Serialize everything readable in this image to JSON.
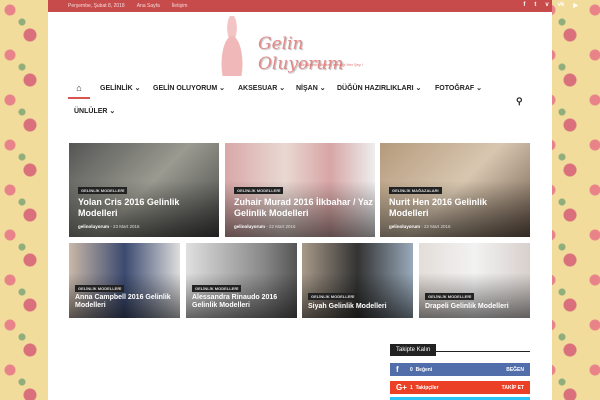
{
  "topbar": {
    "date": "Perşembe, Şubat 8, 2018",
    "links": [
      "Ana Sayfa",
      "İletişim"
    ],
    "social": [
      "facebook-icon",
      "twitter-icon",
      "vimeo-icon",
      "vk-icon",
      "youtube-icon"
    ]
  },
  "logo": {
    "name": "Gelin Oluyorum",
    "tagline": "Bir Gelinin Bilmek İstediği Her Şey !"
  },
  "nav": {
    "items": [
      "GELİNLİK",
      "GELİN OLUYORUM",
      "AKSESUAR",
      "NİŞAN",
      "DÜĞÜN HAZIRLIKLARI",
      "FOTOĞRAF",
      "ÜNLÜLER"
    ]
  },
  "featured": [
    {
      "category": "GELİNLİK MODELLERİ",
      "title": "Yolan Cris 2016 Gelinlik Modelleri",
      "author": "gelinoluyorum",
      "date": "23 Mart 2016"
    },
    {
      "category": "GELİNLİK MODELLERİ",
      "title": "Zuhair Murad 2016 İlkbahar / Yaz Gelinlik Modelleri",
      "author": "gelinoluyorum",
      "date": "22 Mart 2016"
    },
    {
      "category": "GELİNLİK MAĞAZALARI",
      "title": "Nurit Hen 2016 Gelinlik Modelleri",
      "author": "gelinoluyorum",
      "date": "22 Mart 2016"
    },
    {
      "category": "GELİNLİK MODELLERİ",
      "title": "Anna Campbell 2016 Gelinlik Modelleri"
    },
    {
      "category": "GELİNLİK MODELLERİ",
      "title": "Alessandra Rinaudo 2016 Gelinlik Modelleri"
    },
    {
      "category": "GELİNLİK MODELLERİ",
      "title": "Siyah Gelinlik Modelleri"
    },
    {
      "category": "GELİNLİK MODELLERİ",
      "title": "Drapeli Gelinlik Modelleri"
    }
  ],
  "sidebar": {
    "title": "Takipte Kalın",
    "facebook": {
      "count": "0",
      "label": "Beğeni",
      "action": "BEĞEN",
      "color": "#516eab"
    },
    "google": {
      "count": "1",
      "label": "Takipçiler",
      "action": "TAKİP ET",
      "color": "#eb4026"
    }
  }
}
